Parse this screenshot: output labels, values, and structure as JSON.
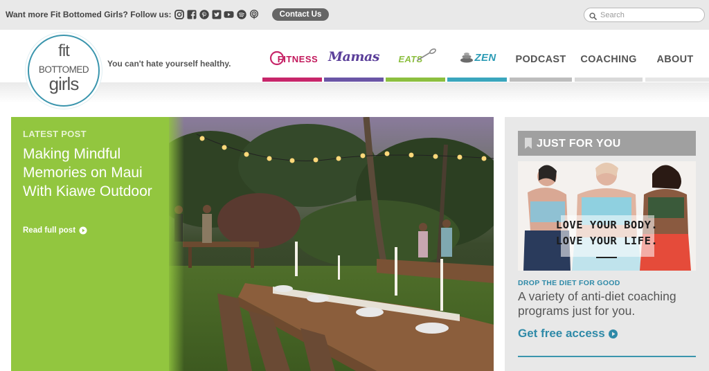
{
  "topbar": {
    "follow_text": "Want more Fit Bottomed Girls? Follow us:",
    "social_icons": [
      "instagram-icon",
      "facebook-icon",
      "pinterest-icon",
      "twitter-icon",
      "youtube-icon",
      "spotify-icon",
      "podcast-icon"
    ],
    "contact_label": "Contact Us",
    "search_placeholder": "Search"
  },
  "header": {
    "logo": {
      "line1": "fit",
      "line2": "BOTTOMED",
      "line3": "girls"
    },
    "tagline": "You can't hate yourself healthy."
  },
  "nav": [
    {
      "label": "FITNESS",
      "color": "#c7266a"
    },
    {
      "label": "Mamas",
      "color": "#6a55a6"
    },
    {
      "label": "EATS",
      "color": "#8cbf3f"
    },
    {
      "label": "ZEN",
      "color": "#3aa6bd"
    },
    {
      "label": "PODCAST",
      "color": "#bdbdbd"
    },
    {
      "label": "COACHING",
      "color": "#d9d9d9"
    },
    {
      "label": "ABOUT",
      "color": "#e6e6e6"
    }
  ],
  "hero": {
    "kicker": "LATEST POST",
    "title": "Making Mindful Memories on Maui With Kiawe Outdoor",
    "read_more": "Read full post",
    "accent_color": "#92c63f"
  },
  "sidebar": {
    "title": "JUST FOR YOU",
    "promo_line1": "LOVE YOUR BODY.",
    "promo_line2": "LOVE YOUR LIFE.",
    "kicker": "DROP THE DIET FOR GOOD",
    "description": "A variety of anti-diet coaching programs just for you.",
    "link_label": "Get free access",
    "accent_color": "#2f8aa8"
  }
}
